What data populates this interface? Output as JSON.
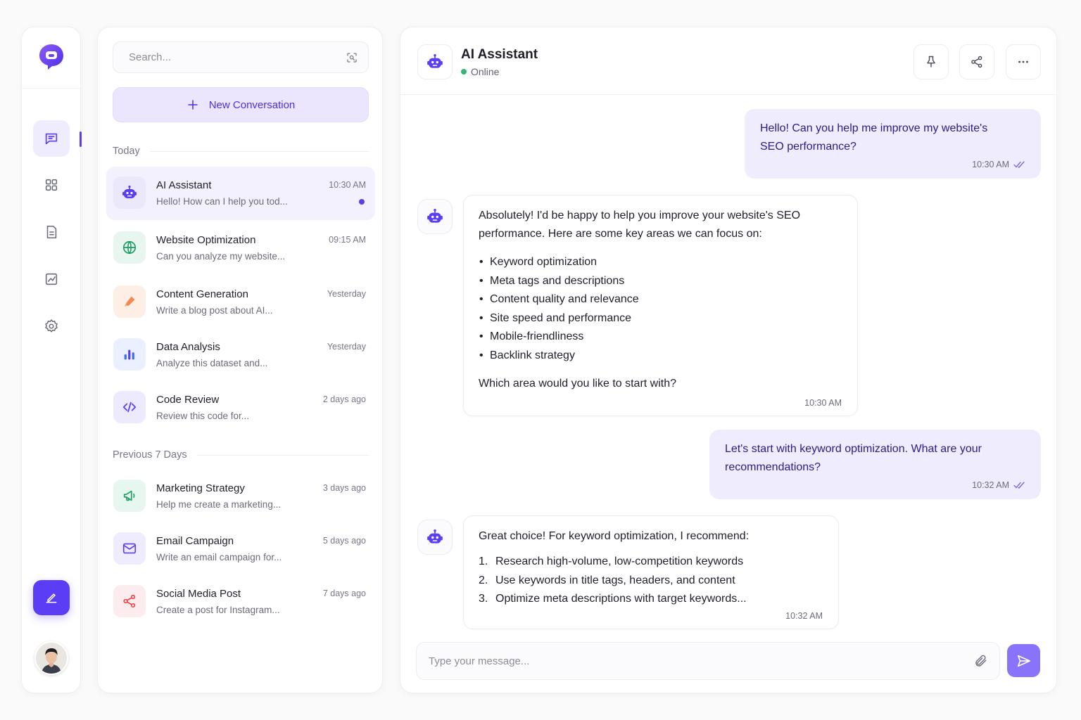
{
  "rail": {
    "items": [
      {
        "icon": "chat-icon",
        "active": true
      },
      {
        "icon": "grid-icon",
        "active": false
      },
      {
        "icon": "document-icon",
        "active": false
      },
      {
        "icon": "analytics-icon",
        "active": false
      },
      {
        "icon": "gear-icon",
        "active": false
      }
    ],
    "compose_icon": "edit-icon",
    "accent": "#5b3df5"
  },
  "sidebar": {
    "search_placeholder": "Search...",
    "new_conversation_label": "New Conversation",
    "sections": [
      {
        "label": "Today",
        "items": [
          {
            "name": "AI Assistant",
            "preview": "Hello! How can I help you tod...",
            "time": "10:30 AM",
            "icon": "robot-icon",
            "unread": true,
            "active": true
          },
          {
            "name": "Website Optimization",
            "preview": "Can you analyze my website...",
            "time": "09:15 AM",
            "icon": "globe-icon"
          },
          {
            "name": "Content Generation",
            "preview": "Write a blog post about AI...",
            "time": "Yesterday",
            "icon": "pencil-icon"
          },
          {
            "name": "Data Analysis",
            "preview": "Analyze this dataset and...",
            "time": "Yesterday",
            "icon": "bar-chart-icon"
          },
          {
            "name": "Code Review",
            "preview": "Review this code for...",
            "time": "2 days ago",
            "icon": "code-icon"
          }
        ]
      },
      {
        "label": "Previous 7 Days",
        "items": [
          {
            "name": "Marketing Strategy",
            "preview": "Help me create a marketing...",
            "time": "3 days ago",
            "icon": "megaphone-icon"
          },
          {
            "name": "Email Campaign",
            "preview": "Write an email campaign for...",
            "time": "5 days ago",
            "icon": "mail-icon"
          },
          {
            "name": "Social Media Post",
            "preview": "Create a post for Instagram...",
            "time": "7 days ago",
            "icon": "share-icon"
          }
        ]
      }
    ]
  },
  "chat": {
    "title": "AI Assistant",
    "status": "Online",
    "status_color": "#2fb774",
    "messages": [
      {
        "from": "user",
        "text_lines": [
          "Hello! Can you help me improve my website's",
          "SEO performance?"
        ],
        "time": "10:30 AM",
        "read": true
      },
      {
        "from": "assistant",
        "intro_lines": [
          "Absolutely! I'd be happy to help you improve your website's SEO",
          "performance. Here are some key areas we can focus on:"
        ],
        "bullets": [
          "Keyword optimization",
          "Meta tags and descriptions",
          "Content quality and relevance",
          "Site speed and performance",
          "Mobile-friendliness",
          "Backlink strategy"
        ],
        "outro": "Which area would you like to start with?",
        "time": "10:30 AM"
      },
      {
        "from": "user",
        "text_lines": [
          "Let's start with keyword optimization. What are your",
          "recommendations?"
        ],
        "time": "10:32 AM",
        "read": true
      },
      {
        "from": "assistant",
        "intro": "Great choice! For keyword optimization, I recommend:",
        "numbered": [
          {
            "n": "1.",
            "text": "Research high-volume, low-competition keywords"
          },
          {
            "n": "2.",
            "text": "Use keywords in title tags, headers, and content"
          },
          {
            "n": "3.",
            "text": "Optimize meta descriptions with target keywords..."
          }
        ],
        "time": "10:32 AM"
      }
    ],
    "composer_placeholder": "Type your message..."
  }
}
